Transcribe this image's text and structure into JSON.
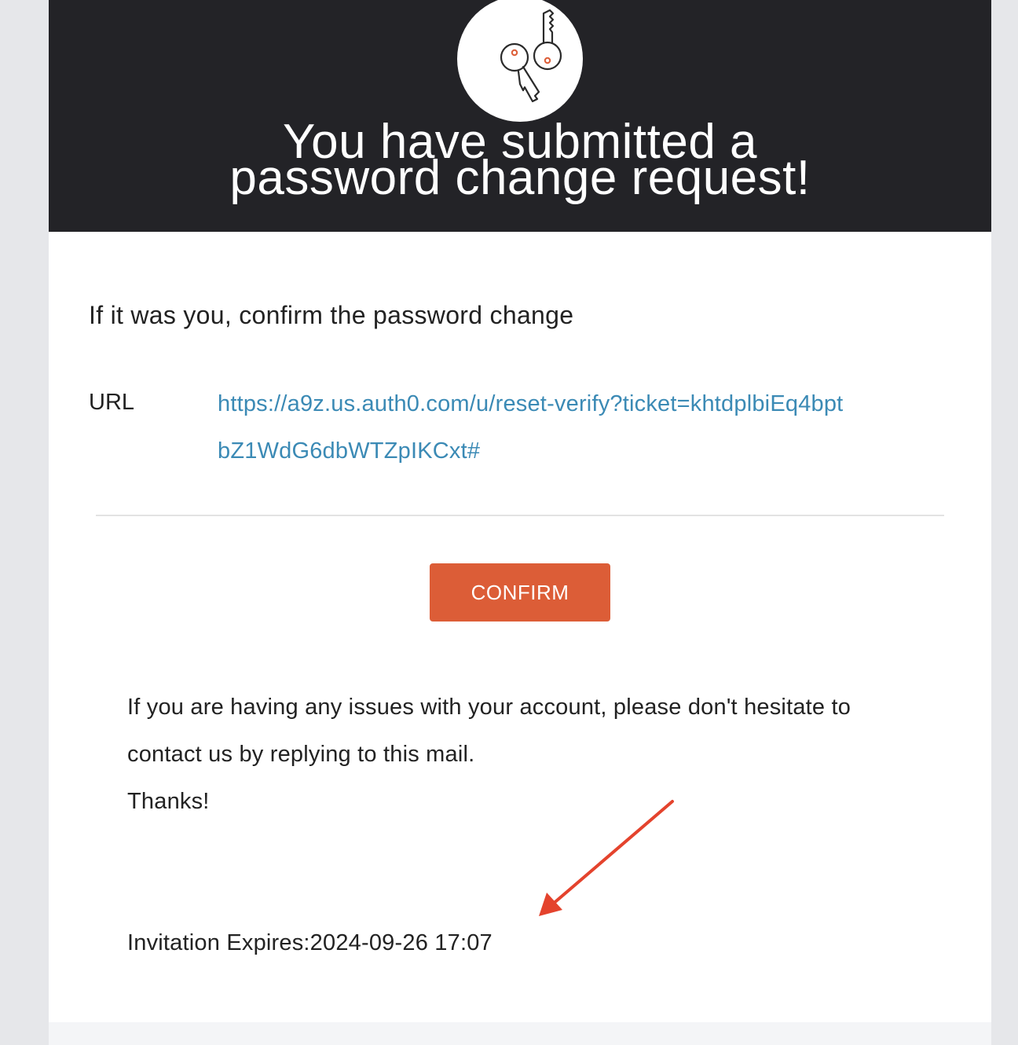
{
  "header": {
    "title_line1": "You have submitted a",
    "title_line2": "password change request!",
    "logo_icon": "keys-icon"
  },
  "content": {
    "subheading": "If it was you, confirm the password change",
    "url_label": "URL",
    "url_text": "https://a9z.us.auth0.com/u/reset-verify?ticket=khtdplbiEq4bptbZ1WdG6dbWTZpIKCxt#",
    "confirm_label": "CONFIRM",
    "body_line1": "If you are having any issues with your account, please don't hesitate to contact us by replying to this mail.",
    "thanks": "Thanks!",
    "expires": "Invitation Expires:2024-09-26 17:07"
  },
  "colors": {
    "header_bg": "#232327",
    "accent": "#dc5d37",
    "link": "#3b8ab5",
    "annotation_arrow": "#e4432d"
  }
}
